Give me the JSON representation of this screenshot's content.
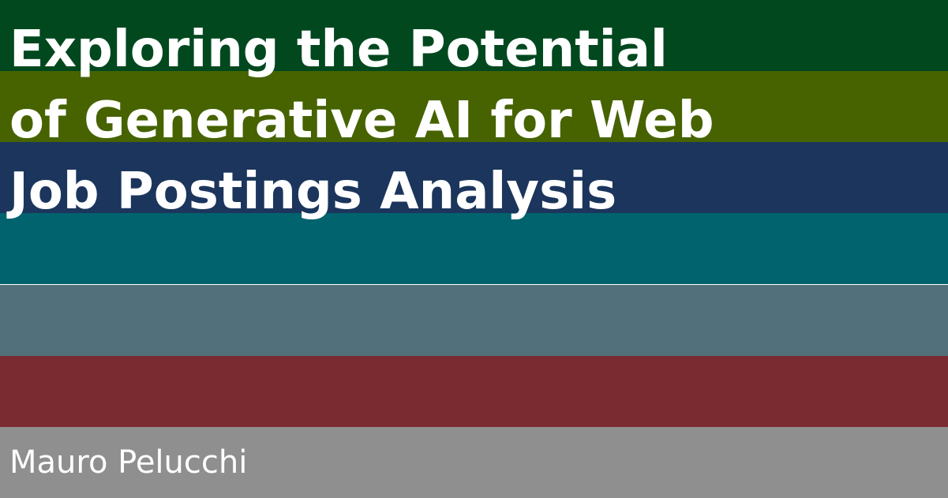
{
  "title": {
    "lines": [
      "Exploring the Potential",
      "of Generative AI for Web",
      "Job Postings Analysis"
    ]
  },
  "author": "Mauro Pelucchi",
  "stripe_colors": [
    "#01481f",
    "#466300",
    "#1b355c",
    "#00636e",
    "#52707b",
    "#7a2a31",
    "#8f8f8f"
  ]
}
